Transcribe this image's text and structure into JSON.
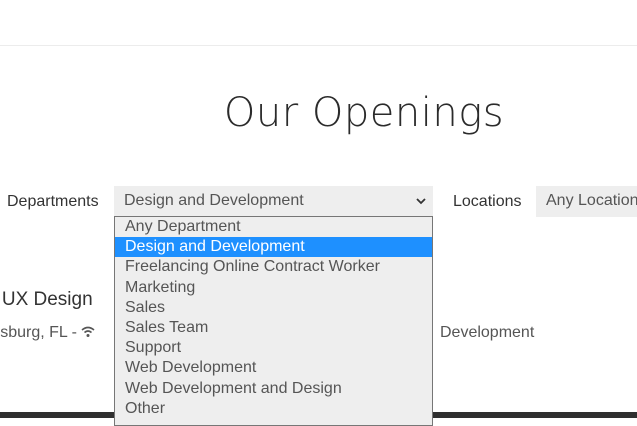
{
  "page": {
    "title": "Our Openings"
  },
  "filters": {
    "departments_label": "Departments",
    "departments_value": "Design and Development",
    "locations_label": "Locations",
    "locations_value": "Any Location"
  },
  "dropdown": {
    "options": [
      "Any Department",
      "Design and Development",
      "Freelancing Online Contract Worker",
      "Marketing",
      "Sales",
      "Sales Team",
      "Support",
      "Web Development",
      "Web Development and Design",
      "Other"
    ],
    "selected": "Design and Development"
  },
  "job": {
    "title": "e UX Design",
    "location": "ersburg, FL -",
    "department": "Development"
  },
  "icons": {
    "select_arrow": "chevron-down-icon",
    "remote": "wifi-icon"
  },
  "colors": {
    "selected_option": "#1e90ff",
    "select_bg": "#eeeeee",
    "footer": "#2f2f2f"
  }
}
